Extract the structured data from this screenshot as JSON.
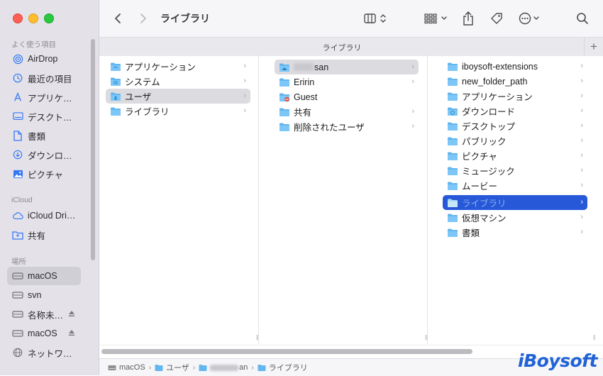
{
  "toolbar": {
    "title": "ライブラリ"
  },
  "tabbar": {
    "label": "ライブラリ",
    "add_label": "+"
  },
  "sidebar": {
    "favorites_header": "よく使う項目",
    "favorites": [
      {
        "label": "AirDrop",
        "icon": "airdrop-icon"
      },
      {
        "label": "最近の項目",
        "icon": "clock-icon"
      },
      {
        "label": "アプリケ…",
        "icon": "applications-icon"
      },
      {
        "label": "デスクト…",
        "icon": "desktop-icon"
      },
      {
        "label": "書類",
        "icon": "document-icon"
      },
      {
        "label": "ダウンロ…",
        "icon": "download-icon"
      },
      {
        "label": "ピクチャ",
        "icon": "photo-icon"
      }
    ],
    "icloud_header": "iCloud",
    "icloud": [
      {
        "label": "iCloud Dri…",
        "icon": "cloud-icon"
      },
      {
        "label": "共有",
        "icon": "shared-folder-icon"
      }
    ],
    "locations_header": "場所",
    "locations": [
      {
        "label": "macOS",
        "icon": "disk-icon"
      },
      {
        "label": "svn",
        "icon": "disk-icon"
      },
      {
        "label": "名称未…",
        "icon": "disk-icon"
      },
      {
        "label": "macOS",
        "icon": "disk-icon"
      },
      {
        "label": "ネットワ…",
        "icon": "network-icon"
      }
    ]
  },
  "columns": {
    "col1": [
      {
        "label": "アプリケーション"
      },
      {
        "label": "システム"
      },
      {
        "label": "ユーザ"
      },
      {
        "label": "ライブラリ"
      }
    ],
    "col2": [
      {
        "label": "san"
      },
      {
        "label": "Eririn"
      },
      {
        "label": "Guest"
      },
      {
        "label": "共有"
      },
      {
        "label": "削除されたユーザ"
      }
    ],
    "col3": [
      {
        "label": "iboysoft-extensions"
      },
      {
        "label": "new_folder_path"
      },
      {
        "label": "アプリケーション"
      },
      {
        "label": "ダウンロード"
      },
      {
        "label": "デスクトップ"
      },
      {
        "label": "パブリック"
      },
      {
        "label": "ピクチャ"
      },
      {
        "label": "ミュージック"
      },
      {
        "label": "ムービー"
      },
      {
        "label": "ライブラリ"
      },
      {
        "label": "仮想マシン"
      },
      {
        "label": "書類"
      }
    ]
  },
  "pathbar": {
    "items": [
      "macOS",
      "ユーザ",
      "an",
      "ライブラリ"
    ]
  },
  "watermark": "iBoysoft",
  "colors": {
    "accent": "#2658d8",
    "folder": "#63b6ee",
    "sidebar": "#e4e2e8"
  }
}
